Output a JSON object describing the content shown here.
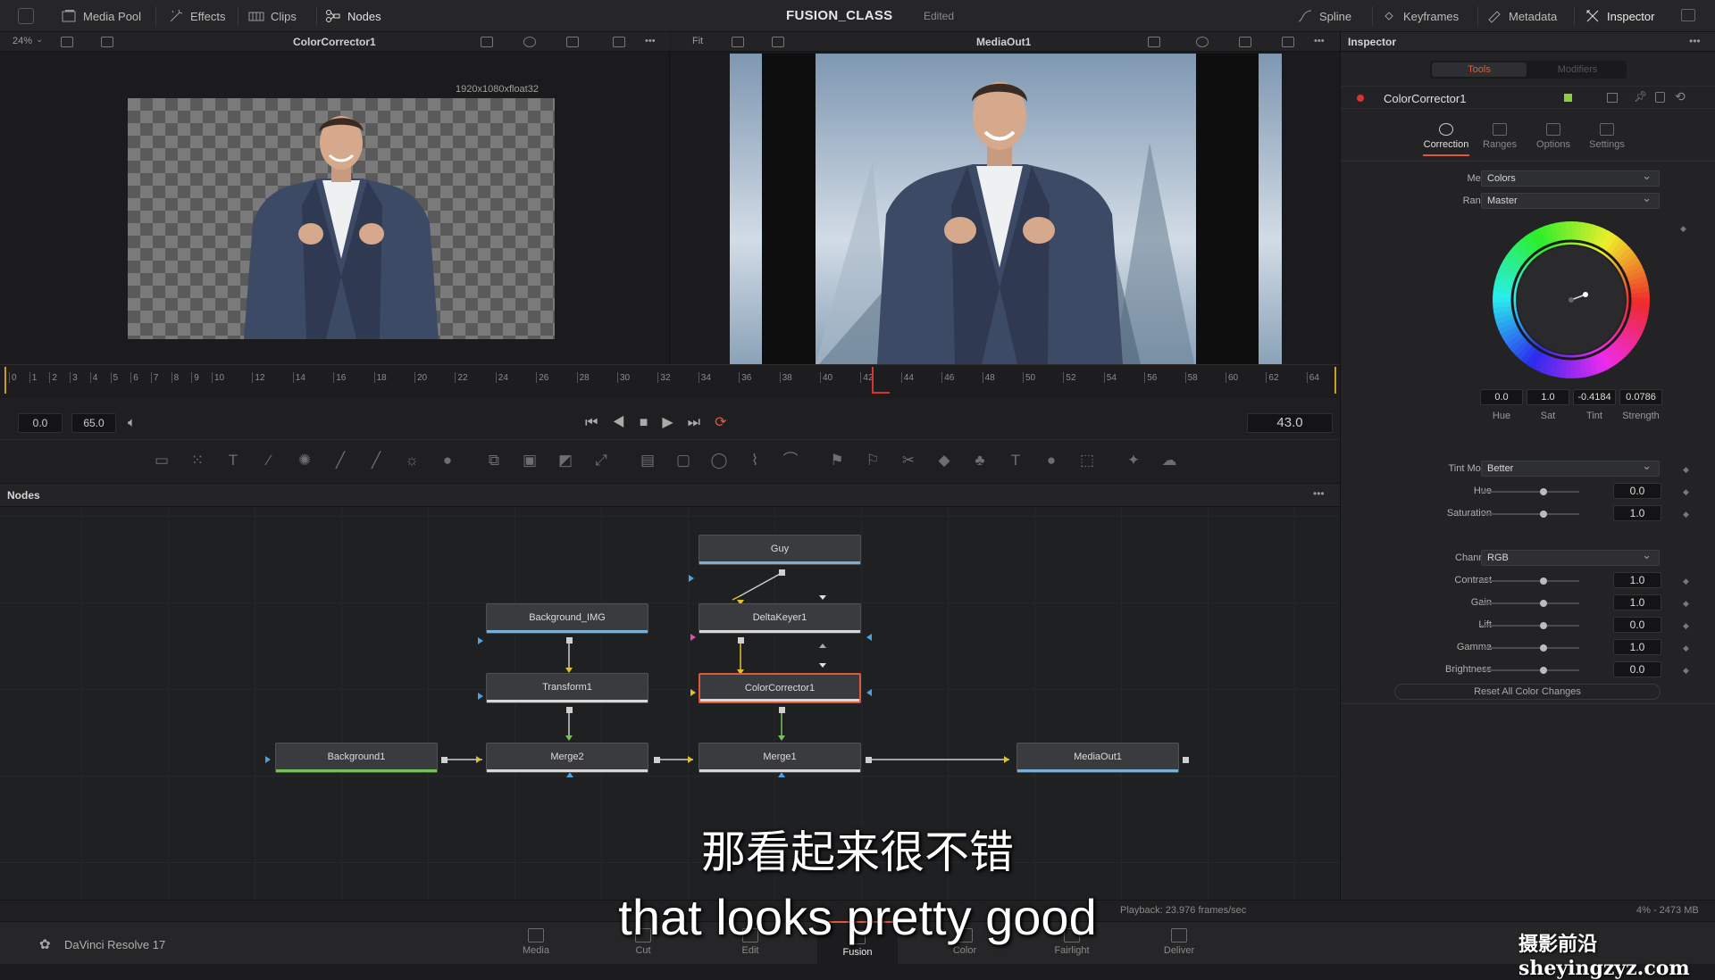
{
  "topbar": {
    "left_items": [
      {
        "label": "Media Pool",
        "icon": "media-pool-icon"
      },
      {
        "label": "Effects",
        "icon": "effects-icon"
      },
      {
        "label": "Clips",
        "icon": "clips-icon"
      },
      {
        "label": "Nodes",
        "icon": "nodes-icon"
      }
    ],
    "project_title": "FUSION_CLASS",
    "project_status": "Edited",
    "right_items": [
      {
        "label": "Spline",
        "icon": "spline-icon"
      },
      {
        "label": "Keyframes",
        "icon": "keyframes-icon"
      },
      {
        "label": "Metadata",
        "icon": "metadata-icon"
      },
      {
        "label": "Inspector",
        "icon": "inspector-icon"
      }
    ]
  },
  "viewer_left": {
    "zoom": "24%",
    "title": "ColorCorrector1",
    "resolution": "1920x1080xfloat32"
  },
  "viewer_right": {
    "zoom": "Fit",
    "title": "MediaOut1"
  },
  "timeline": {
    "ticks": [
      "0",
      "1",
      "2",
      "3",
      "4",
      "5",
      "6",
      "7",
      "8",
      "9",
      "10",
      "12",
      "14",
      "16",
      "18",
      "20",
      "22",
      "24",
      "26",
      "28",
      "30",
      "32",
      "34",
      "36",
      "38",
      "40",
      "42",
      "44",
      "46",
      "48",
      "50",
      "52",
      "54",
      "56",
      "58",
      "60",
      "62",
      "64"
    ],
    "start": "0.0",
    "end": "65.0",
    "current": "43.0"
  },
  "nodes_panel": {
    "title": "Nodes"
  },
  "nodes": {
    "guy": "Guy",
    "deltakeyer": "DeltaKeyer1",
    "background_img": "Background_IMG",
    "transform": "Transform1",
    "colorcorrector": "ColorCorrector1",
    "background": "Background1",
    "merge2": "Merge2",
    "merge1": "Merge1",
    "mediaout": "MediaOut1"
  },
  "inspector": {
    "title": "Inspector",
    "tabs": [
      "Tools",
      "Modifiers"
    ],
    "tool_name": "ColorCorrector1",
    "subtabs": [
      "Correction",
      "Ranges",
      "Options",
      "Settings"
    ],
    "menu": {
      "label": "Menu",
      "value": "Colors"
    },
    "range": {
      "label": "Range",
      "value": "Master"
    },
    "wheel_values": [
      {
        "label": "Hue",
        "value": "0.0"
      },
      {
        "label": "Sat",
        "value": "1.0"
      },
      {
        "label": "Tint",
        "value": "-0.4184"
      },
      {
        "label": "Strength",
        "value": "0.0786"
      }
    ],
    "tint_mode": {
      "label": "Tint Mode",
      "value": "Better"
    },
    "hue": {
      "label": "Hue",
      "value": "0.0"
    },
    "saturation": {
      "label": "Saturation",
      "value": "1.0"
    },
    "channel": {
      "label": "Channel",
      "value": "RGB"
    },
    "contrast": {
      "label": "Contrast",
      "value": "1.0"
    },
    "gain": {
      "label": "Gain",
      "value": "1.0"
    },
    "lift": {
      "label": "Lift",
      "value": "0.0"
    },
    "gamma": {
      "label": "Gamma",
      "value": "1.0"
    },
    "brightness": {
      "label": "Brightness",
      "value": "0.0"
    },
    "reset_label": "Reset All Color Changes"
  },
  "status": {
    "playback": "Playback: 23.976 frames/sec",
    "memory": "4% - 2473 MB"
  },
  "app_name": "DaVinci Resolve 17",
  "pages": [
    "Media",
    "Cut",
    "Edit",
    "Fusion",
    "Color",
    "Fairlight",
    "Deliver"
  ],
  "active_page": "Fusion",
  "subtitle": {
    "cn": "那看起来很不错",
    "en": "that looks pretty good"
  },
  "watermark": "摄影前沿 sheyingzyz.com",
  "colors": {
    "accent": "#e0593d",
    "orange": "#f07a3c",
    "keyer_bar": "#7ab0d8",
    "merge_bar": "#d8d8d8",
    "bg_bar": "#79c05b"
  }
}
